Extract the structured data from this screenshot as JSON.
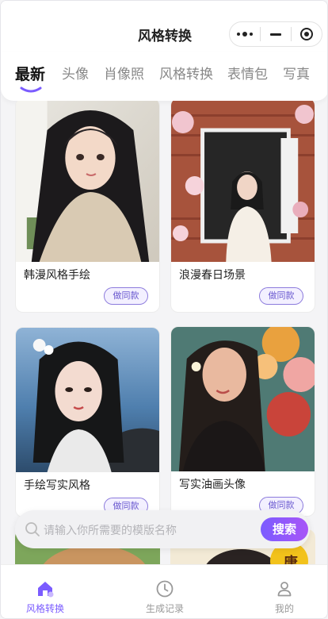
{
  "header": {
    "title": "风格转换"
  },
  "tabs": [
    {
      "label": "最新",
      "active": true
    },
    {
      "label": "头像",
      "active": false
    },
    {
      "label": "肖像照",
      "active": false
    },
    {
      "label": "风格转换",
      "active": false
    },
    {
      "label": "表情包",
      "active": false
    },
    {
      "label": "写真",
      "active": false
    }
  ],
  "cards": [
    {
      "title": "韩漫风格手绘",
      "button": "做同款"
    },
    {
      "title": "浪漫春日场景",
      "button": "做同款"
    },
    {
      "title": "手绘写实风格",
      "button": "做同款"
    },
    {
      "title": "写实油画头像",
      "button": "做同款"
    }
  ],
  "peek_badge": "唐",
  "search": {
    "placeholder": "请输入你所需要的模版名称",
    "button": "搜索"
  },
  "bottom_nav": [
    {
      "label": "风格转换",
      "icon": "home-icon",
      "active": true
    },
    {
      "label": "生成记录",
      "icon": "clock-icon",
      "active": false
    },
    {
      "label": "我的",
      "icon": "user-icon",
      "active": false
    }
  ],
  "colors": {
    "accent": "#7b5cff",
    "accent_light": "#f3f0ff"
  }
}
